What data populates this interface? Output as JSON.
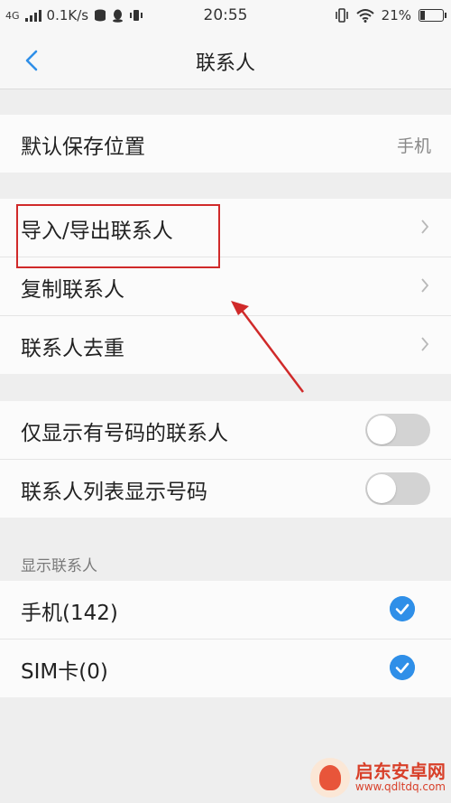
{
  "status_bar": {
    "network_type": "4G",
    "speed": "0.1K/s",
    "time": "20:55",
    "battery": "21%",
    "battery_level": 0.21
  },
  "nav": {
    "title": "联系人"
  },
  "storage_row": {
    "label": "默认保存位置",
    "value": "手机"
  },
  "menu_rows": [
    {
      "label": "导入/导出联系人"
    },
    {
      "label": "复制联系人"
    },
    {
      "label": "联系人去重"
    }
  ],
  "toggle_rows": [
    {
      "label": "仅显示有号码的联系人",
      "on": false
    },
    {
      "label": "联系人列表显示号码",
      "on": false
    }
  ],
  "display_section": {
    "header": "显示联系人",
    "items": [
      {
        "label": "手机(142)",
        "checked": true
      },
      {
        "label": "SIM卡(0)",
        "checked": true
      }
    ]
  },
  "watermark": {
    "title": "启东安卓网",
    "url": "www.qdltdq.com"
  },
  "colors": {
    "accent": "#2f8fe8",
    "annotation": "#d02a2a",
    "toggle_off": "#d3d3d3"
  }
}
